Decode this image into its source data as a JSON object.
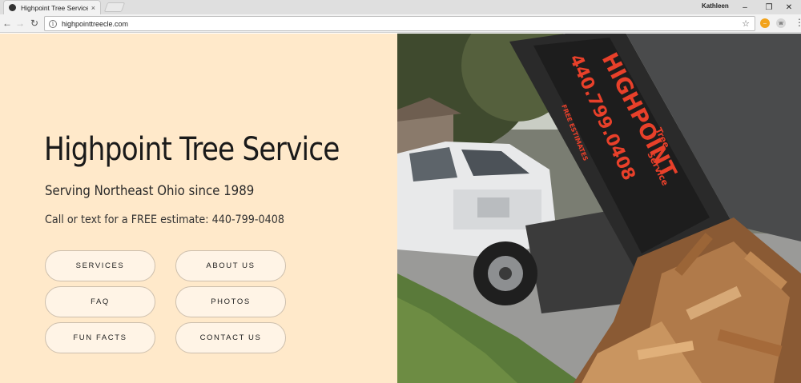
{
  "browser": {
    "tab_title": "Highpoint Tree Service -",
    "tab_close": "×",
    "profile_name": "Kathleen",
    "url": "highpointtreecle.com",
    "window_controls": {
      "minimize": "–",
      "restore": "❐",
      "close": "✕"
    },
    "nav": {
      "back": "←",
      "forward": "→",
      "reload": "↻"
    },
    "star": "☆",
    "extension_w": "w",
    "menu": "⋮"
  },
  "hero": {
    "title": "Highpoint Tree Service",
    "tagline": "Serving Northeast Ohio since 1989",
    "estimate": "Call or text for a FREE estimate: 440-799-0408"
  },
  "buttons": {
    "services": "SERVICES",
    "about": "ABOUT US",
    "faq": "FAQ",
    "photos": "PHOTOS",
    "fun_facts": "FUN FACTS",
    "contact": "CONTACT US"
  },
  "truck_sign": {
    "brand": "HIGHPOINT",
    "phone": "440.799.0408",
    "free_estimates": "FREE ESTIMATES",
    "tree": "Tree",
    "service": "Service"
  },
  "colors": {
    "panel_bg": "#ffe9ca",
    "button_bg": "#fff4e6",
    "sign_red": "#e8402a"
  }
}
